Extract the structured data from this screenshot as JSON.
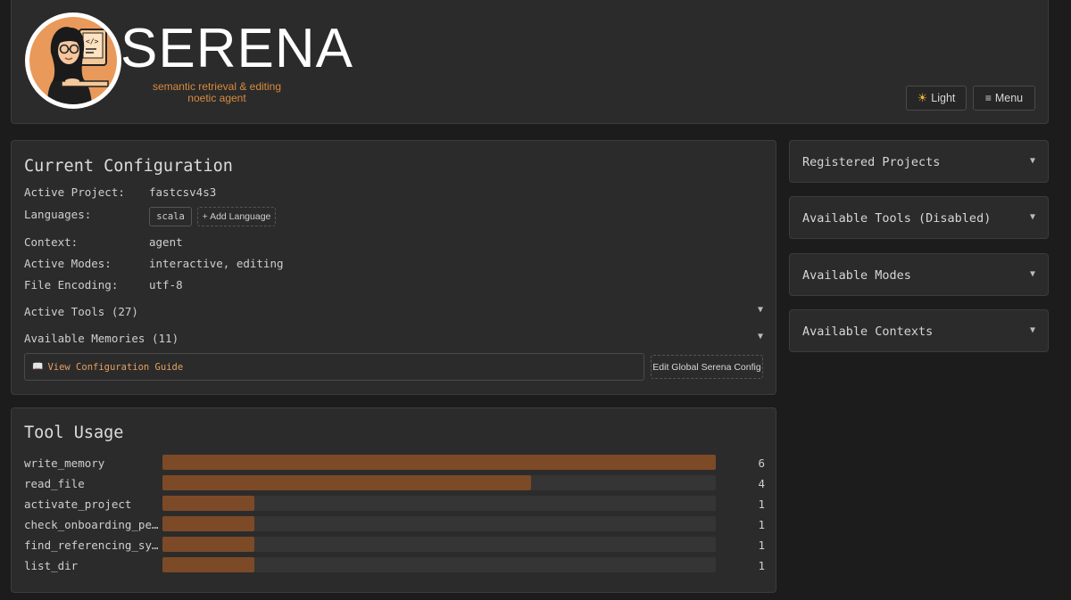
{
  "header": {
    "title": "SERENA",
    "subtitle_line1": "semantic retrieval & editing",
    "subtitle_line2": "noetic agent",
    "theme_button": "Light",
    "theme_icon": "sun-icon",
    "menu_button": "Menu",
    "menu_icon": "hamburger-icon",
    "accent_color": "#d98a3e"
  },
  "config": {
    "title": "Current Configuration",
    "active_project_label": "Active Project:",
    "active_project": "fastcsv4s3",
    "languages_label": "Languages:",
    "languages": [
      "scala"
    ],
    "add_language": "+ Add Language",
    "context_label": "Context:",
    "context": "agent",
    "modes_label": "Active Modes:",
    "modes": "interactive, editing",
    "encoding_label": "File Encoding:",
    "encoding": "utf-8",
    "active_tools": "Active Tools (27)",
    "memories": "Available Memories (11)",
    "guide_icon": "book-icon",
    "guide_link": "View Configuration Guide",
    "edit_config": "Edit Global Serena Config"
  },
  "usage": {
    "title": "Tool Usage",
    "max": 6,
    "tools": [
      {
        "name": "write_memory",
        "count": 6
      },
      {
        "name": "read_file",
        "count": 4
      },
      {
        "name": "activate_project",
        "count": 1
      },
      {
        "name": "check_onboarding_pe…",
        "count": 1
      },
      {
        "name": "find_referencing_sy…",
        "count": 1
      },
      {
        "name": "list_dir",
        "count": 1
      }
    ]
  },
  "sidebar": {
    "sections": [
      {
        "label": "Registered Projects"
      },
      {
        "label": "Available Tools (Disabled)"
      },
      {
        "label": "Available Modes"
      },
      {
        "label": "Available Contexts"
      }
    ]
  }
}
